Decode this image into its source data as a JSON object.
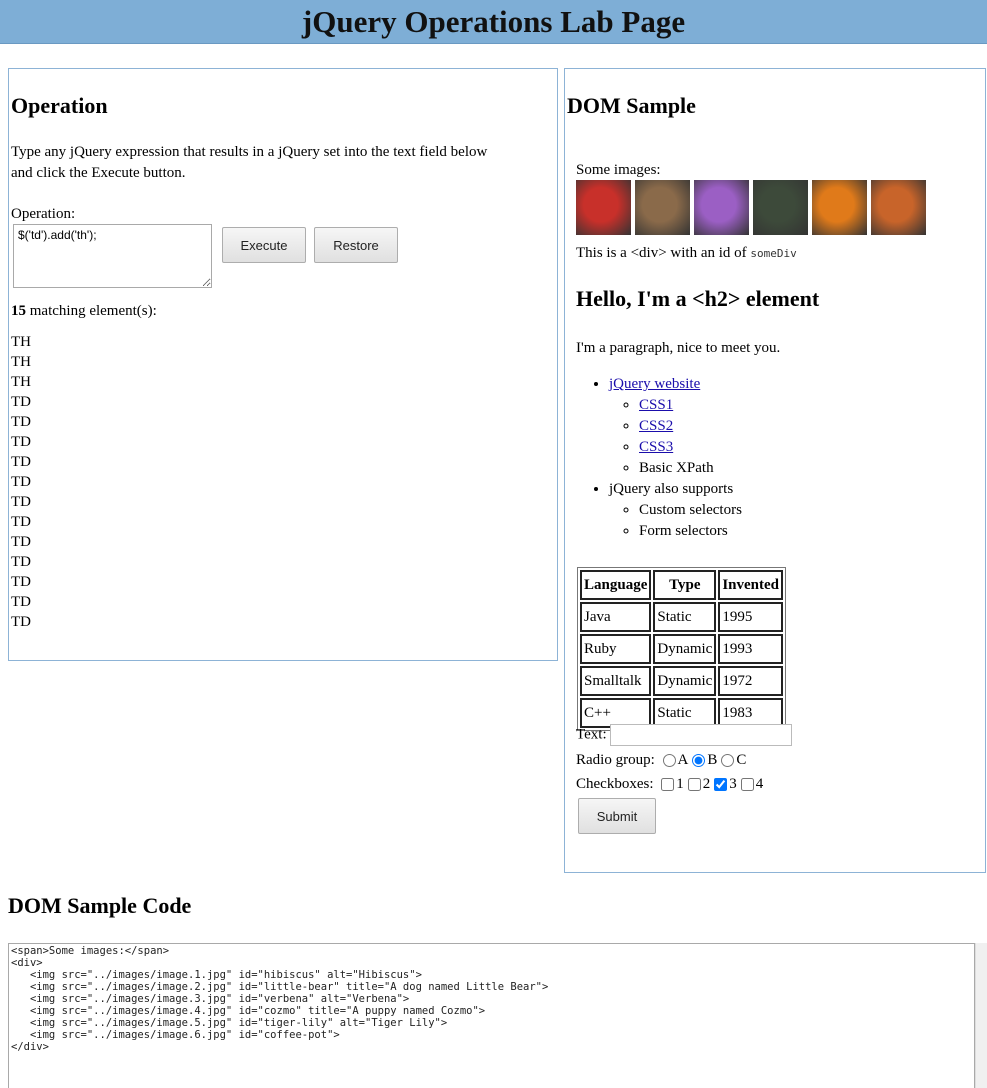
{
  "page_title": "jQuery Operations Lab Page",
  "operation": {
    "heading": "Operation",
    "description": "Type any jQuery expression that results in a jQuery set into the text field below and click the Execute button.",
    "label": "Operation:",
    "value": "$('td').add('th');",
    "execute_label": "Execute",
    "restore_label": "Restore",
    "match_count": "15",
    "match_suffix": "matching element(s):",
    "results": [
      "TH",
      "TH",
      "TH",
      "TD",
      "TD",
      "TD",
      "TD",
      "TD",
      "TD",
      "TD",
      "TD",
      "TD",
      "TD",
      "TD",
      "TD"
    ]
  },
  "dom_sample": {
    "heading": "DOM Sample",
    "images_label": "Some images:",
    "images": [
      {
        "name": "hibiscus-image",
        "color": "#c8302a"
      },
      {
        "name": "little-bear-image",
        "color": "#8a6a4a"
      },
      {
        "name": "verbena-image",
        "color": "#9b5fc4"
      },
      {
        "name": "cozmo-image",
        "color": "#3d4a3a"
      },
      {
        "name": "tiger-lily-image",
        "color": "#e07a1a"
      },
      {
        "name": "coffee-pot-image",
        "color": "#c8642a"
      }
    ],
    "div_text_prefix": "This is a <div> with an id of",
    "div_id": "someDiv",
    "h2_text": "Hello, I'm a <h2> element",
    "paragraph": "I'm a paragraph, nice to meet you.",
    "list": {
      "jquery_website": "jQuery website",
      "css1": "CSS1",
      "css2": "CSS2",
      "css3": "CSS3",
      "basic_xpath": "Basic XPath",
      "also_supports": "jQuery also supports",
      "custom_selectors": "Custom selectors",
      "form_selectors": "Form selectors"
    },
    "table": {
      "headers": [
        "Language",
        "Type",
        "Invented"
      ],
      "rows": [
        [
          "Java",
          "Static",
          "1995"
        ],
        [
          "Ruby",
          "Dynamic",
          "1993"
        ],
        [
          "Smalltalk",
          "Dynamic",
          "1972"
        ],
        [
          "C++",
          "Static",
          "1983"
        ]
      ]
    },
    "form": {
      "text_label": "Text:",
      "radio_label": "Radio group:",
      "radio_options": [
        "A",
        "B",
        "C"
      ],
      "radio_selected": "B",
      "checkbox_label": "Checkboxes:",
      "checkbox_options": [
        "1",
        "2",
        "3",
        "4"
      ],
      "checkbox_checked": "3",
      "submit_label": "Submit"
    }
  },
  "code_section": {
    "heading": "DOM Sample Code",
    "lines": [
      "<span>Some images:</span>",
      "<div>",
      "   <img src=\"../images/image.1.jpg\" id=\"hibiscus\" alt=\"Hibiscus\">",
      "   <img src=\"../images/image.2.jpg\" id=\"little-bear\" title=\"A dog named Little Bear\">",
      "   <img src=\"../images/image.3.jpg\" id=\"verbena\" alt=\"Verbena\">",
      "   <img src=\"../images/image.4.jpg\" id=\"cozmo\" title=\"A puppy named Cozmo\">",
      "   <img src=\"../images/image.5.jpg\" id=\"tiger-lily\" alt=\"Tiger Lily\">",
      "   <img src=\"../images/image.6.jpg\" id=\"coffee-pot\">",
      "</div>"
    ]
  }
}
